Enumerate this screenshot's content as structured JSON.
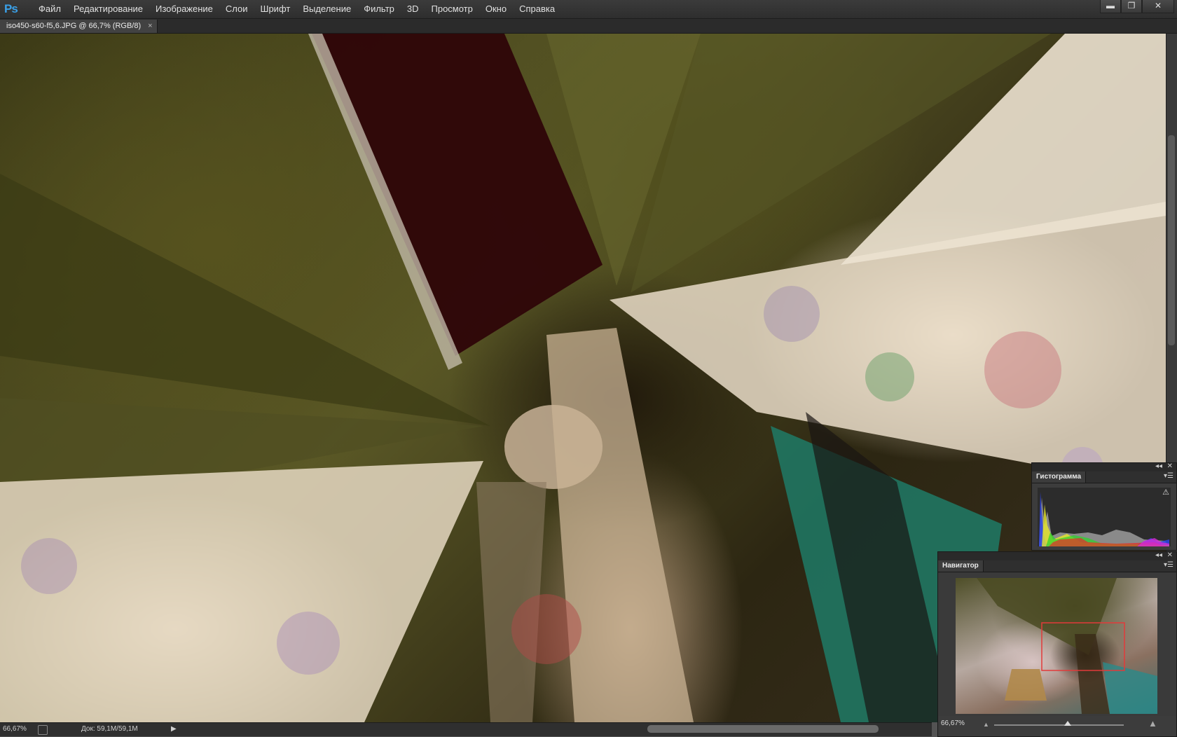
{
  "app": {
    "logo": "Ps"
  },
  "menu": [
    "Файл",
    "Редактирование",
    "Изображение",
    "Слои",
    "Шрифт",
    "Выделение",
    "Фильтр",
    "3D",
    "Просмотр",
    "Окно",
    "Справка"
  ],
  "window_controls": {
    "minimize": "▬",
    "restore": "❐",
    "close": "✕"
  },
  "document": {
    "tab_title": "iso450-s60-f5,6.JPG @ 66,7% (RGB/8)",
    "tab_close": "×"
  },
  "status": {
    "zoom": "66,67%",
    "doc_info": "Док: 59,1M/59,1M",
    "arrow": "▶"
  },
  "histogram": {
    "title": "Гистограмма",
    "warning_icon": "⚠",
    "menu_icon": "▾☰",
    "collapse": "◂◂",
    "close": "✕"
  },
  "navigator": {
    "title": "Навигатор",
    "zoom": "66,67%",
    "menu_icon": "▾☰",
    "collapse": "◂◂",
    "close": "✕",
    "view_box_color": "#e23a3a"
  },
  "colors": {
    "accent": "#3aa0e8"
  }
}
